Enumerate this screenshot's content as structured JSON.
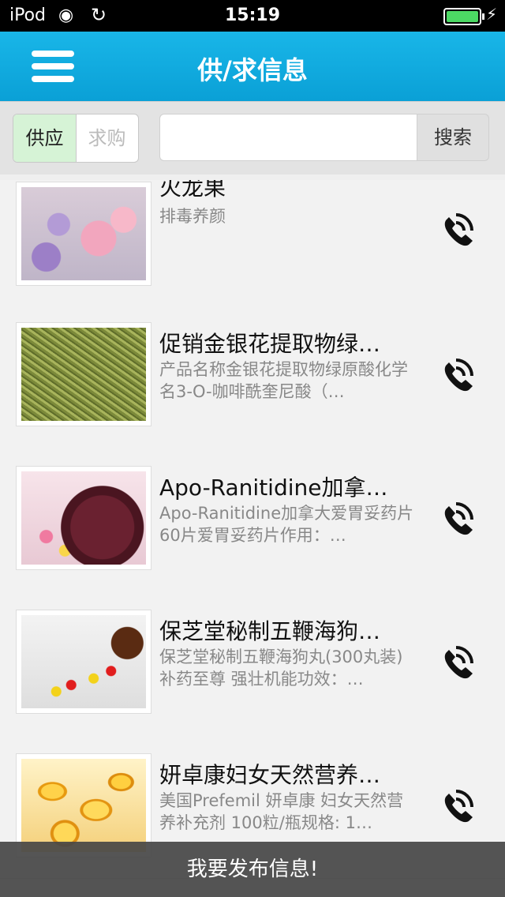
{
  "status_bar": {
    "carrier": "iPod",
    "time": "15:19"
  },
  "header": {
    "title": "供/求信息"
  },
  "filter": {
    "supply_label": "供应",
    "demand_label": "求购",
    "search_placeholder": "",
    "search_button": "搜索"
  },
  "items": [
    {
      "name": "火龙果",
      "desc": "排毒养颜",
      "image": "meringue-photo"
    },
    {
      "name": "促销金银花提取物绿…",
      "desc": "产品名称金银花提取物绿原酸化学名3-O-咖啡酰奎尼酸（…",
      "image": "honeysuckle-photo"
    },
    {
      "name": "Apo-Ranitidine加拿…",
      "desc": "Apo-Ranitidine加拿大爱胃妥药片60片爱胃妥药片作用：…",
      "image": "pill-bottle-photo"
    },
    {
      "name": "保芝堂秘制五鞭海狗…",
      "desc": "保芝堂秘制五鞭海狗丸(300丸装)补药至尊 强壮机能功效：…",
      "image": "capsules-photo"
    },
    {
      "name": "妍卓康妇女天然营养…",
      "desc": "美国Prefemil 妍卓康 妇女天然营养补充剂 100粒/瓶规格: 1…",
      "image": "softgel-photo"
    }
  ],
  "bottom_bar": {
    "label": "我要发布信息!"
  },
  "colors": {
    "header": "#0aa0d6",
    "supply_active": "#d6f3d6",
    "bottom_bar": "#464646"
  }
}
